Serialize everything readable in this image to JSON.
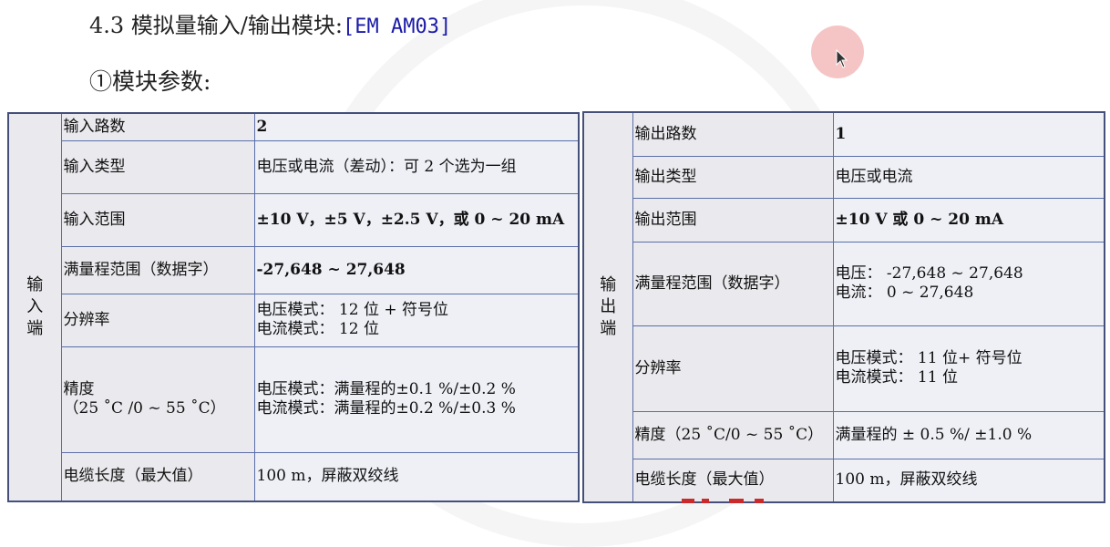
{
  "heading": {
    "number": "4.3",
    "title": "模拟量输入/输出模块:",
    "tag": "[EM AM03]"
  },
  "subheading": "①模块参数:",
  "input_table": {
    "side": "输入端",
    "rows": [
      {
        "label": "输入路数",
        "value": "2"
      },
      {
        "label": "输入类型",
        "value": "电压或电流（差动）：可 2 个选为一组"
      },
      {
        "label": "输入范围",
        "value": "±10 V，±5 V，±2.5 V，或 0 ~ 20 mA"
      },
      {
        "label": "满量程范围（数据字）",
        "value": "-27,648 ~ 27,648"
      },
      {
        "label": "分辨率",
        "value": "电压模式： 12 位 + 符号位\n电流模式： 12 位"
      },
      {
        "label": "精度\n（25 ˚C /0 ~ 55 ˚C）",
        "value": "电压模式：满量程的±0.1 %/±0.2 %\n电流模式：满量程的±0.2 %/±0.3 %"
      },
      {
        "label": "电缆长度（最大值）",
        "value": "100 m，屏蔽双绞线"
      }
    ]
  },
  "output_table": {
    "side": "输出端",
    "rows": [
      {
        "label": "输出路数",
        "value": "1"
      },
      {
        "label": "输出类型",
        "value": "电压或电流"
      },
      {
        "label": "输出范围",
        "value": "±10 V 或 0 ~ 20 mA"
      },
      {
        "label": "满量程范围（数据字）",
        "value": "电压： -27,648 ~ 27,648\n电流： 0 ~ 27,648"
      },
      {
        "label": "分辨率",
        "value": "电压模式： 11 位+ 符号位\n电流模式： 11 位"
      },
      {
        "label": "精度（25 ˚C/0 ~ 55 ˚C）",
        "value": "满量程的 ± 0.5 %/ ±1.0 %"
      },
      {
        "label": "电缆长度（最大值）",
        "value": "100 m，屏蔽双绞线"
      }
    ]
  },
  "colors": {
    "heading_tag": "#1a1aa8",
    "border": "#5a6ea8",
    "label_bg": "#eaeaee",
    "value_bg": "#eef0f6",
    "cursor_highlight": "#ec9696"
  }
}
